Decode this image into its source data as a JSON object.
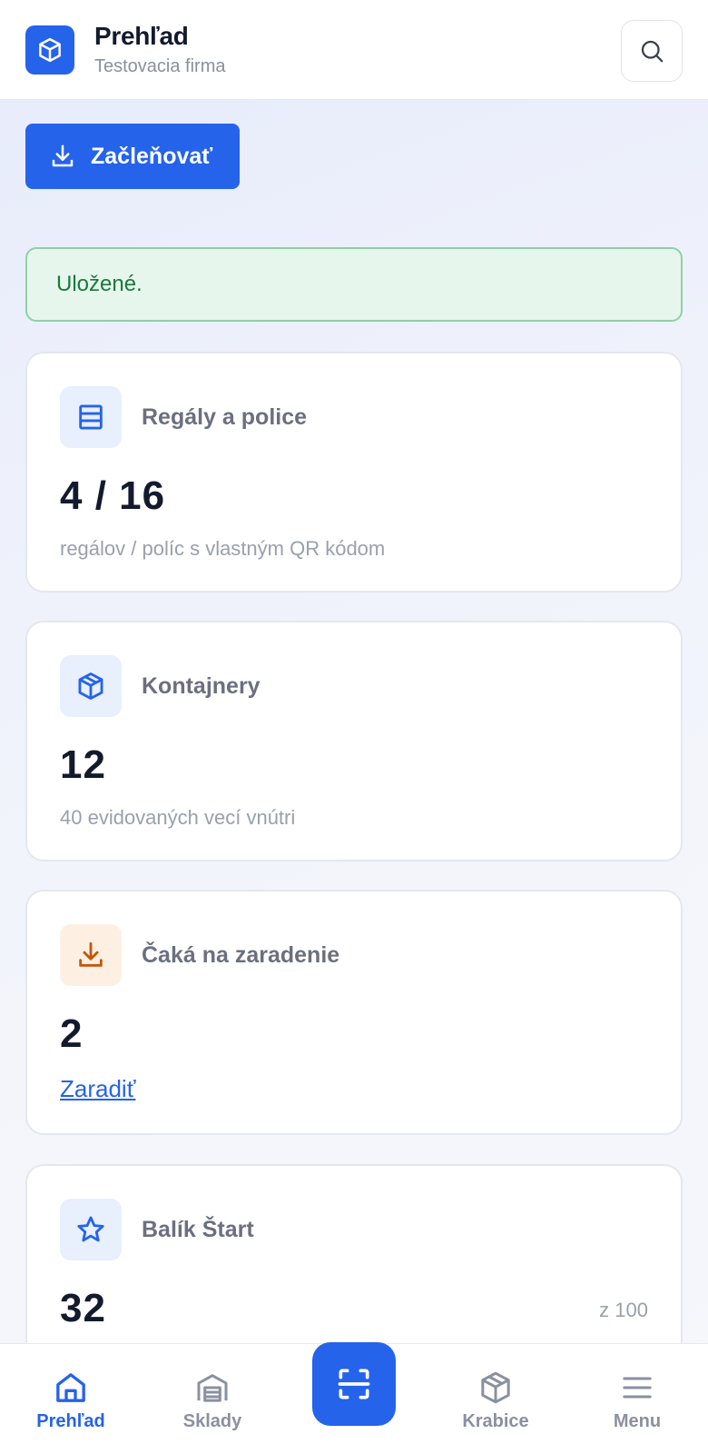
{
  "header": {
    "title": "Prehľad",
    "subtitle": "Testovacia firma",
    "logo_icon": "box-icon",
    "search_icon": "search-icon"
  },
  "actions": {
    "import_label": "Začleňovať",
    "import_icon": "download-icon"
  },
  "alert": {
    "message": "Uložené."
  },
  "cards": [
    {
      "icon": "shelves-icon",
      "title": "Regály a police",
      "value": "4 / 16",
      "description": "regálov / políc s vlastným QR kódom"
    },
    {
      "icon": "box-icon",
      "title": "Kontajnery",
      "value": "12",
      "description": "40 evidovaných vecí vnútri"
    },
    {
      "icon": "download-icon",
      "title": "Čaká na zaradenie",
      "value": "2",
      "link": "Zaradiť"
    },
    {
      "icon": "star-icon",
      "title": "Balík Štart",
      "value": "32",
      "aside": "z 100"
    }
  ],
  "bottom_nav": {
    "items": [
      {
        "label": "Prehľad",
        "icon": "home-icon",
        "active": true
      },
      {
        "label": "Sklady",
        "icon": "warehouse-icon",
        "active": false
      },
      {
        "label": "Krabice",
        "icon": "box-icon",
        "active": false
      },
      {
        "label": "Menu",
        "icon": "menu-icon",
        "active": false
      }
    ],
    "scan_icon": "scan-icon"
  },
  "colors": {
    "accent": "#2563eb",
    "success_bg": "#e7f6ec",
    "success_text": "#187a3c",
    "warning_icon": "#c2570c"
  }
}
